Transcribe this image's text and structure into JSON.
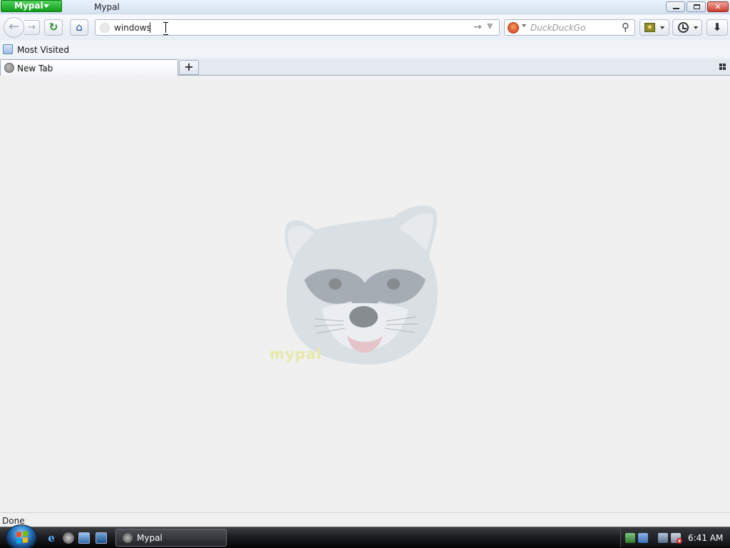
{
  "window": {
    "app_menu_label": "Mypal",
    "title": "Mypal"
  },
  "navbar": {
    "url_value": "windows",
    "search_engine": "DuckDuckGo",
    "search_placeholder": "DuckDuckGo"
  },
  "bookmarks_bar": {
    "items": [
      {
        "label": "Most Visited",
        "icon": "most-visited-icon"
      }
    ]
  },
  "tabs": [
    {
      "label": "New Tab",
      "active": true
    }
  ],
  "content": {
    "watermark_logo_text": "mypal"
  },
  "status_bar": {
    "text": "Done"
  },
  "taskbar": {
    "task_items": [
      {
        "label": "Mypal"
      }
    ],
    "clock": "6:41 AM"
  },
  "colors": {
    "app_menu_green": "#129c1c",
    "content_background": "#f0f0f0",
    "taskbar_dark": "#1c1d20"
  }
}
